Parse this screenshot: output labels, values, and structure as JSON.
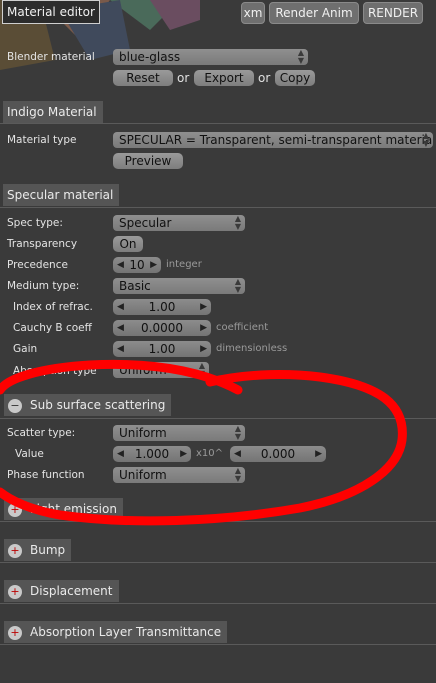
{
  "header": {
    "title": "Material editor",
    "xm_label": "xm",
    "render_anim_label": "Render Anim",
    "render_label": "RENDER"
  },
  "blender_material": {
    "label": "Blender material",
    "value": "blue-glass",
    "reset_label": "Reset",
    "or1": "or",
    "export_label": "Export",
    "or2": "or",
    "copy_label": "Copy"
  },
  "indigo": {
    "section_title": "Indigo Material",
    "type_label": "Material type",
    "type_value": "SPECULAR = Transparent, semi-transparent  material",
    "preview_label": "Preview"
  },
  "specular": {
    "section_title": "Specular material",
    "spec_type_label": "Spec type:",
    "spec_type_value": "Specular",
    "transparency_label": "Transparency",
    "transparency_value": "On",
    "precedence_label": "Precedence",
    "precedence_value": "10",
    "precedence_hint": "integer",
    "medium_type_label": "Medium type:",
    "medium_type_value": "Basic",
    "ior_label": "Index of refrac.",
    "ior_value": "1.00",
    "cauchy_label": "Cauchy B coeff",
    "cauchy_value": "0.0000",
    "cauchy_hint": "coefficient",
    "gain_label": "Gain",
    "gain_value": "1.00",
    "gain_hint": "dimensionless",
    "absorption_label": "Absorption type",
    "absorption_value": "Uniform"
  },
  "sss": {
    "section_title": "Sub surface scattering",
    "toggle": "−",
    "scatter_type_label": "Scatter type:",
    "scatter_type_value": "Uniform",
    "value_label": "Value",
    "value_mantissa": "1.000",
    "value_exp_label": "x10^",
    "value_exponent": "0.000",
    "phase_label": "Phase function",
    "phase_value": "Uniform"
  },
  "collapsed_sections": [
    {
      "label": "Light emission",
      "toggle": "+"
    },
    {
      "label": "Bump",
      "toggle": "+"
    },
    {
      "label": "Displacement",
      "toggle": "+"
    },
    {
      "label": "Absorption Layer Transmittance",
      "toggle": "+"
    }
  ],
  "colors": {
    "background": "#3a3a3a",
    "annotation_red": "#ff0000",
    "button_gray": "#8a8a8a"
  }
}
